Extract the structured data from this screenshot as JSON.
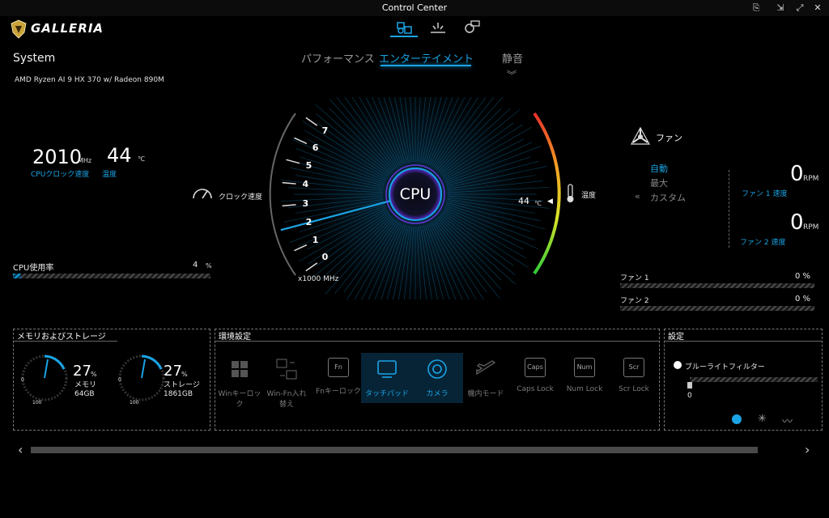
{
  "window": {
    "title": "Control Center"
  },
  "brand": {
    "name": "GALLERIA"
  },
  "modes": {
    "items": [
      "パフォーマンス",
      "エンターテイメント",
      "静音"
    ],
    "active": "エンターテイメント"
  },
  "system": {
    "title": "System",
    "cpu_name": "AMD Ryzen AI 9 HX 370 w/ Radeon 890M",
    "clock_value": "2010",
    "clock_unit": "MHz",
    "clock_label": "CPUクロック速度",
    "temp_value": "44",
    "temp_unit": "℃",
    "temp_label": "温度",
    "usage_label": "CPU使用率",
    "usage_value": "4",
    "usage_unit": "%",
    "usage_fraction": 0.04
  },
  "gauge": {
    "center_label": "CPU",
    "clock_title": "クロック速度",
    "scale": [
      "0",
      "1",
      "2",
      "3",
      "4",
      "5",
      "6",
      "7"
    ],
    "scale_unit": "x1000 MHz",
    "needle_value": 2.01,
    "temp_title": "温度",
    "temp_readout": "44",
    "temp_unit": "℃"
  },
  "fan": {
    "title": "ファン",
    "modes": [
      "自動",
      "最大",
      "カスタム"
    ],
    "active_mode": "自動",
    "fan1_value": "0",
    "fan1_unit": "RPM",
    "fan1_label": "ファン 1 速度",
    "fan2_value": "0",
    "fan2_unit": "RPM",
    "fan2_label": "ファン 2 速度",
    "bars": [
      {
        "label": "ファン 1",
        "value": "0 %",
        "fraction": 0
      },
      {
        "label": "ファン 2",
        "value": "0 %",
        "fraction": 0
      }
    ]
  },
  "memory": {
    "title": "メモリおよびストレージ",
    "mem_value": "27",
    "mem_unit": "%",
    "mem_label": "メモリ",
    "mem_size": "64GB",
    "storage_value": "27",
    "storage_unit": "%",
    "storage_label": "ストレージ",
    "storage_size": "1861GB",
    "dial_min": "0",
    "dial_max": "100"
  },
  "env": {
    "title": "環境設定",
    "items": [
      {
        "label": "Winキーロック",
        "icon": "windows-key-icon",
        "on": false
      },
      {
        "label": "Win-Fn入れ替え",
        "icon": "swap-keys-icon",
        "on": false
      },
      {
        "label": "Fnキーロック",
        "icon": "fn-key-icon",
        "key": "Fn",
        "on": false
      },
      {
        "label": "タッチパッド",
        "icon": "touchpad-icon",
        "on": true
      },
      {
        "label": "カメラ",
        "icon": "camera-icon",
        "on": true
      },
      {
        "label": "機内モード",
        "icon": "airplane-icon",
        "on": false
      },
      {
        "label": "Caps Lock",
        "icon": "caps-key-icon",
        "key": "Caps",
        "on": false
      },
      {
        "label": "Num Lock",
        "icon": "num-key-icon",
        "key": "Num",
        "on": false
      },
      {
        "label": "Scr Lock",
        "icon": "scr-key-icon",
        "key": "Scr",
        "on": false
      }
    ]
  },
  "settings": {
    "title": "設定",
    "bluelight_label": "ブルーライトフィルター",
    "bluelight_value": "0"
  },
  "colors": {
    "accent": "#1aa4e6",
    "bg": "#000000"
  }
}
